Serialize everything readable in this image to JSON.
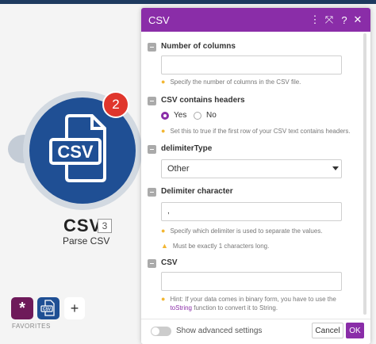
{
  "module": {
    "name": "CSV",
    "number": "3",
    "subtitle": "Parse CSV",
    "badge_count": "2",
    "icon_label": "CSV",
    "icon": "csv-file-icon"
  },
  "favorites": {
    "label": "FAVORITES",
    "items": [
      {
        "icon": "asterisk-app-icon",
        "glyph": "*"
      },
      {
        "icon": "csv-app-icon",
        "glyph": "CSV"
      }
    ],
    "add_glyph": "+"
  },
  "dialog": {
    "title": "CSV",
    "header_icons": [
      "more-vertical-icon",
      "expand-icon",
      "help-icon",
      "close-icon"
    ],
    "header_glyphs": [
      "⋮",
      "⤧",
      "?",
      "✕"
    ],
    "accent_color": "#8a2da8",
    "fields": {
      "number_of_columns": {
        "label": "Number of columns",
        "value": "",
        "hint": "Specify the number of columns in the CSV file."
      },
      "contains_headers": {
        "label": "CSV contains headers",
        "options": [
          "Yes",
          "No"
        ],
        "selected": "Yes",
        "hint": "Set this to true if the first row of your CSV text contains headers."
      },
      "delimiter_type": {
        "label": "delimiterType",
        "value": "Other"
      },
      "delimiter_character": {
        "label": "Delimiter character",
        "value": ",",
        "hint": "Specify which delimiter is used to separate the values.",
        "warning": "Must be exactly 1 characters long."
      },
      "csv": {
        "label": "CSV",
        "value": "",
        "hint_prefix": "Hint: If your data comes in binary form, you have to use the",
        "hint_code": "toString",
        "hint_suffix": "function to convert it to String."
      }
    },
    "footer": {
      "advanced_label": "Show advanced settings",
      "advanced_on": false,
      "cancel_label": "Cancel",
      "ok_label": "OK"
    }
  }
}
